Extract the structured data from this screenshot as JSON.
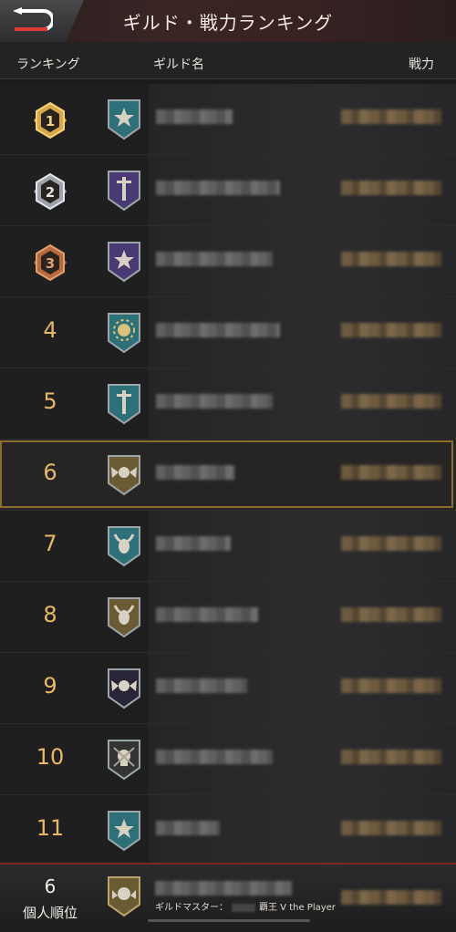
{
  "header": {
    "title": "ギルド・戦力ランキング",
    "back_icon": "back-arrow-icon"
  },
  "columns": {
    "ranking": "ランキング",
    "guild_name": "ギルド名",
    "power": "戦力"
  },
  "rows": [
    {
      "rank": "1",
      "medal": "gold",
      "emblem": "star",
      "emblem_color": "#2f6f78"
    },
    {
      "rank": "2",
      "medal": "silver",
      "emblem": "sword",
      "emblem_color": "#4a3a73"
    },
    {
      "rank": "3",
      "medal": "bronze",
      "emblem": "star",
      "emblem_color": "#4a3a73"
    },
    {
      "rank": "4",
      "medal": null,
      "emblem": "sun",
      "emblem_color": "#2f6f78"
    },
    {
      "rank": "5",
      "medal": null,
      "emblem": "sword",
      "emblem_color": "#2f6f78"
    },
    {
      "rank": "6",
      "medal": null,
      "emblem": "skull-wings",
      "emblem_color": "#6a5b35",
      "highlight": true
    },
    {
      "rank": "7",
      "medal": null,
      "emblem": "bull",
      "emblem_color": "#2f6f78"
    },
    {
      "rank": "8",
      "medal": null,
      "emblem": "bull",
      "emblem_color": "#6a5b35"
    },
    {
      "rank": "9",
      "medal": null,
      "emblem": "skull-wings",
      "emblem_color": "#2a2438"
    },
    {
      "rank": "10",
      "medal": null,
      "emblem": "skull",
      "emblem_color": "#343434"
    },
    {
      "rank": "11",
      "medal": null,
      "emblem": "star",
      "emblem_color": "#2f6f78"
    }
  ],
  "footer": {
    "rank": "6",
    "label": "個人順位",
    "master_label": "ギルドマスター：",
    "master_name": "覇王 V the Player"
  },
  "colors": {
    "accent_gold": "#e9b864",
    "highlight_border": "#8a6d2f",
    "header_red": "#3b2222"
  }
}
